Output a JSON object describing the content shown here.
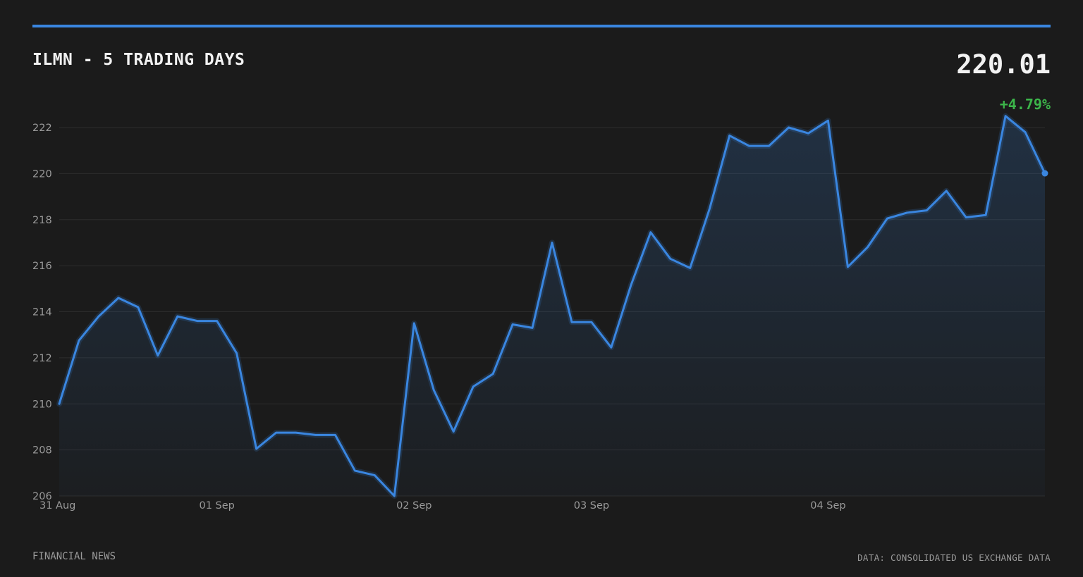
{
  "header": {
    "title": "ILMN - 5 TRADING DAYS",
    "price": "220.01",
    "change": "+4.79%"
  },
  "footer": {
    "left": "FINANCIAL NEWS",
    "right": "DATA: CONSOLIDATED US EXCHANGE DATA"
  },
  "colors": {
    "background": "#1b1b1b",
    "accent": "#3a86e0",
    "positive": "#3cb54a",
    "text": "#f2f2f2",
    "muted": "#9a9a9a"
  },
  "chart_data": {
    "type": "area",
    "title": "ILMN - 5 TRADING DAYS",
    "xlabel": "",
    "ylabel": "",
    "ylim": [
      206,
      222
    ],
    "yticks": [
      206,
      208,
      210,
      212,
      214,
      216,
      218,
      220,
      222
    ],
    "xticks": [
      {
        "label": "31 Aug",
        "index": 0
      },
      {
        "label": "01 Sep",
        "index": 8
      },
      {
        "label": "02 Sep",
        "index": 18
      },
      {
        "label": "03 Sep",
        "index": 27
      },
      {
        "label": "04 Sep",
        "index": 39
      }
    ],
    "grid": true,
    "legend": "none",
    "series": [
      {
        "values": [
          210.0,
          212.75,
          213.8,
          214.6,
          214.2,
          212.1,
          213.8,
          213.6,
          213.6,
          212.2,
          208.05,
          208.75,
          208.75,
          208.65,
          208.65,
          207.1,
          206.9,
          206.0,
          213.5,
          210.6,
          208.8,
          210.75,
          211.3,
          213.45,
          213.3,
          217.0,
          213.55,
          213.55,
          212.45,
          215.15,
          217.45,
          216.3,
          215.9,
          218.5,
          221.65,
          221.2,
          221.2,
          222.0,
          221.75,
          222.3,
          215.95,
          216.8,
          218.05,
          218.3,
          218.4,
          219.25,
          218.1,
          218.2,
          222.5,
          221.8,
          220.01
        ]
      }
    ]
  }
}
